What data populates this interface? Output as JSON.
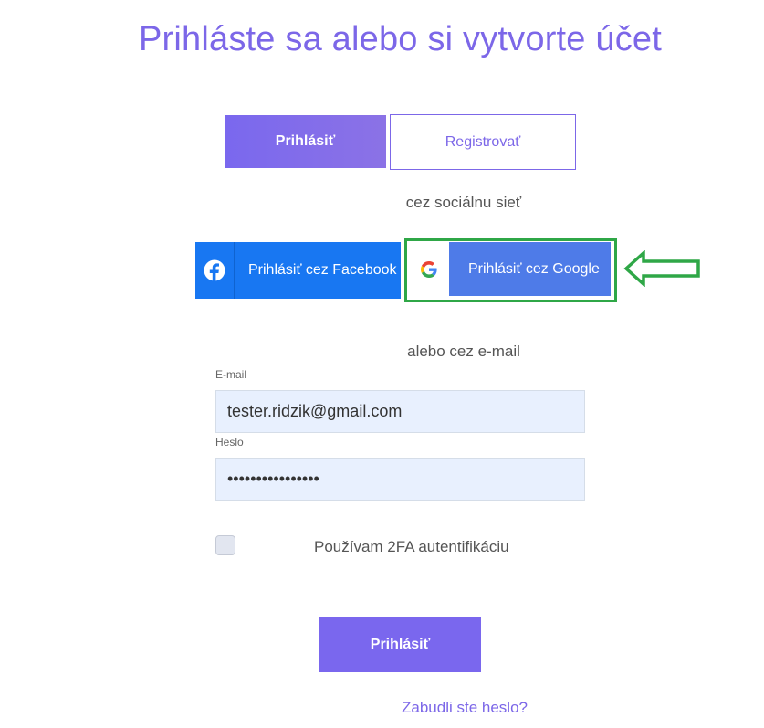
{
  "page": {
    "title": "Prihláste sa alebo si vytvorte účet"
  },
  "tabs": {
    "login_label": "Prihlásiť",
    "register_label": "Registrovať"
  },
  "social": {
    "label": "cez sociálnu sieť",
    "facebook_label": "Prihlásiť cez Facebook",
    "google_label": "Prihlásiť cez Google"
  },
  "email_section": {
    "label": "alebo cez e-mail",
    "email_field_label": "E-mail",
    "email_value": "tester.ridzik@gmail.com",
    "password_field_label": "Heslo",
    "password_value": "••••••••••••••••"
  },
  "twofa": {
    "label": "Používam 2FA autentifikáciu",
    "checked": false
  },
  "submit_label": "Prihlásiť",
  "forgot_label": "Zabudli ste heslo?",
  "colors": {
    "accent": "#7c67e8",
    "facebook": "#1877f2",
    "google": "#4e7be8",
    "highlight": "#2fa747"
  },
  "icons": {
    "facebook": "facebook-icon",
    "google": "google-icon",
    "arrow": "arrow-left-outline-icon"
  }
}
